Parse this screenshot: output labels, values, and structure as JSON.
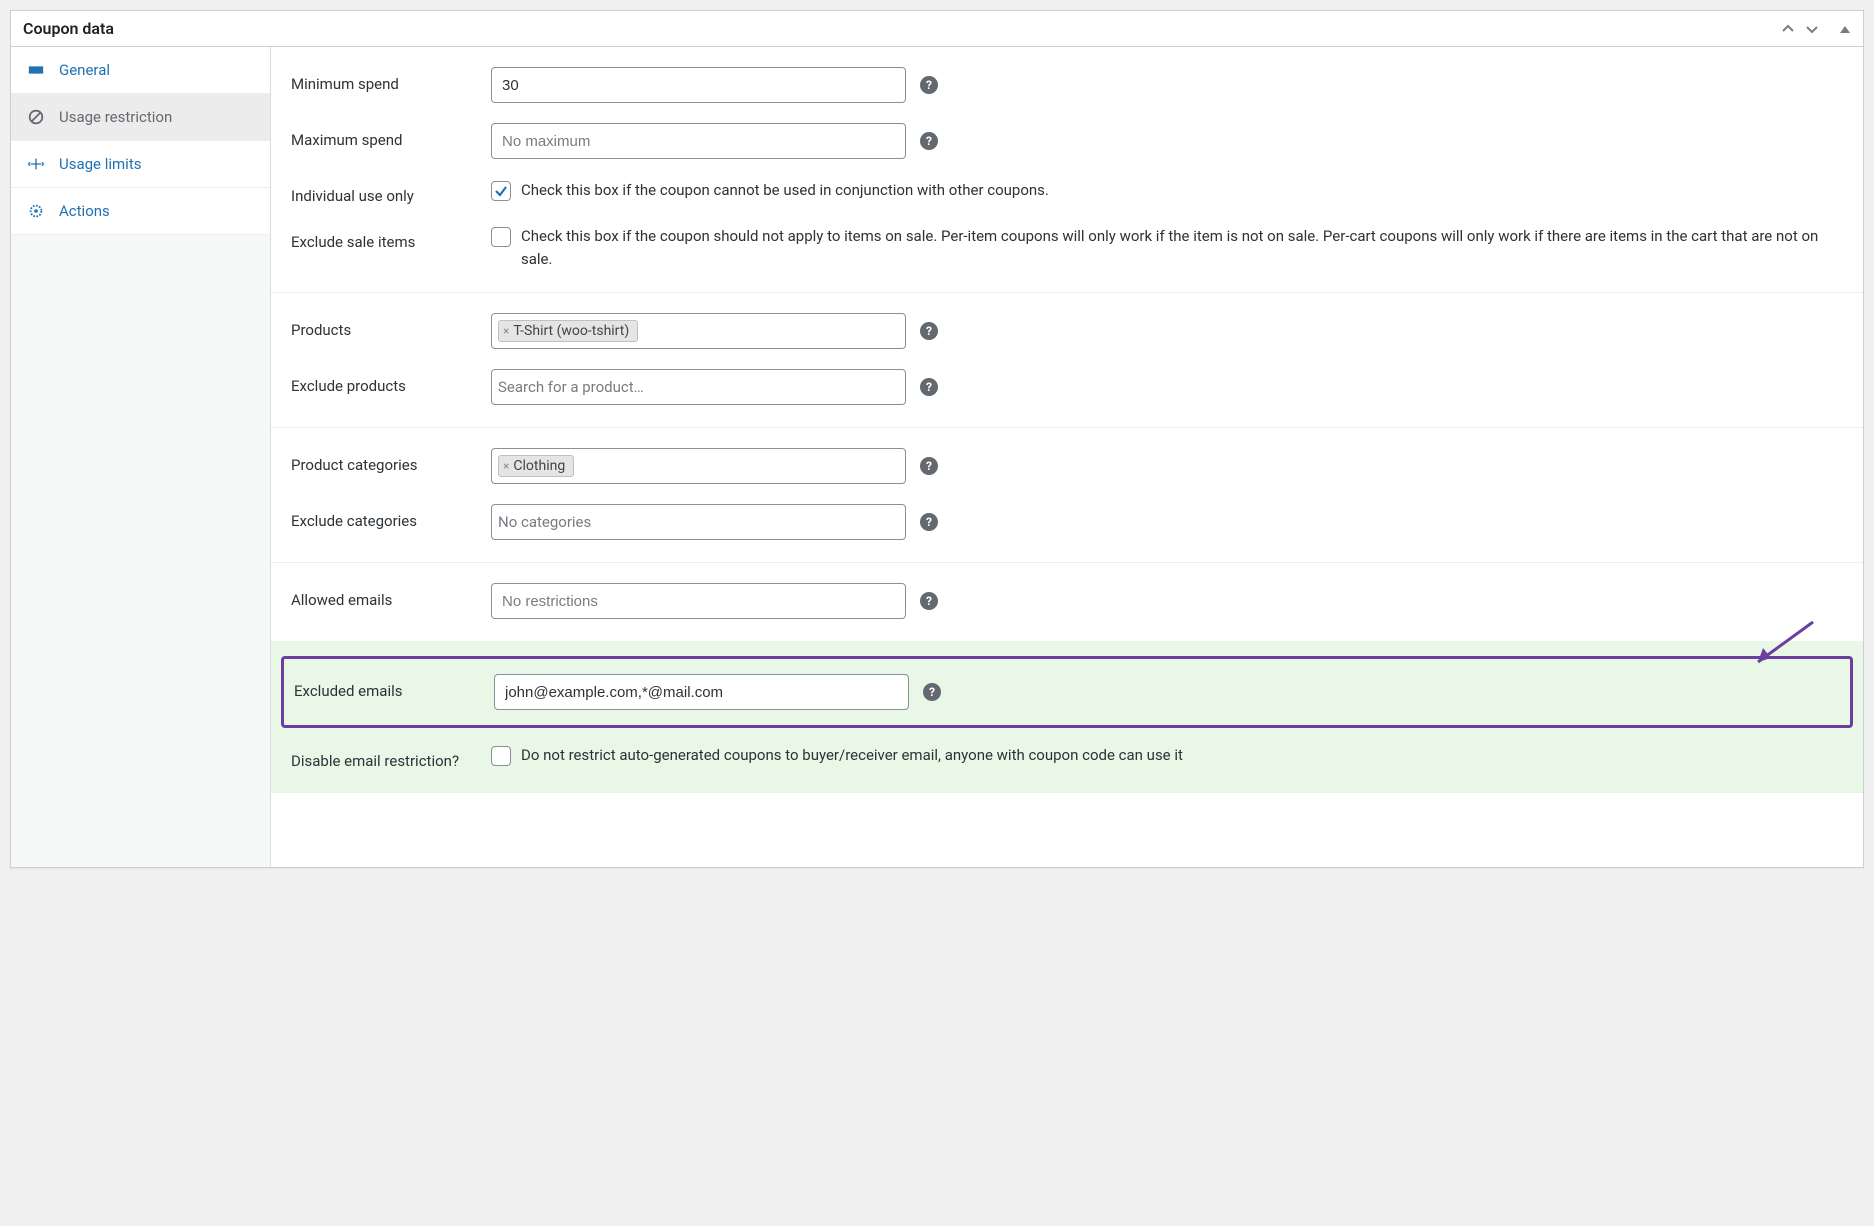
{
  "panel": {
    "title": "Coupon data"
  },
  "tabs": {
    "items": [
      {
        "label": "General"
      },
      {
        "label": "Usage restriction"
      },
      {
        "label": "Usage limits"
      },
      {
        "label": "Actions"
      }
    ]
  },
  "fields": {
    "minimum_spend": {
      "label": "Minimum spend",
      "value": "30"
    },
    "maximum_spend": {
      "label": "Maximum spend",
      "placeholder": "No maximum"
    },
    "individual_use": {
      "label": "Individual use only",
      "description": "Check this box if the coupon cannot be used in conjunction with other coupons."
    },
    "exclude_sale": {
      "label": "Exclude sale items",
      "description": "Check this box if the coupon should not apply to items on sale. Per-item coupons will only work if the item is not on sale. Per-cart coupons will only work if there are items in the cart that are not on sale."
    },
    "products": {
      "label": "Products",
      "tags": [
        "T-Shirt (woo-tshirt)"
      ]
    },
    "exclude_products": {
      "label": "Exclude products",
      "placeholder": "Search for a product…"
    },
    "categories": {
      "label": "Product categories",
      "tags": [
        "Clothing"
      ]
    },
    "exclude_categories": {
      "label": "Exclude categories",
      "placeholder": "No categories"
    },
    "allowed_emails": {
      "label": "Allowed emails",
      "placeholder": "No restrictions"
    },
    "excluded_emails": {
      "label": "Excluded emails",
      "value": "john@example.com,*@mail.com"
    },
    "disable_email_restriction": {
      "label": "Disable email restriction?",
      "description": "Do not restrict auto-generated coupons to buyer/receiver email, anyone with coupon code can use it"
    }
  }
}
